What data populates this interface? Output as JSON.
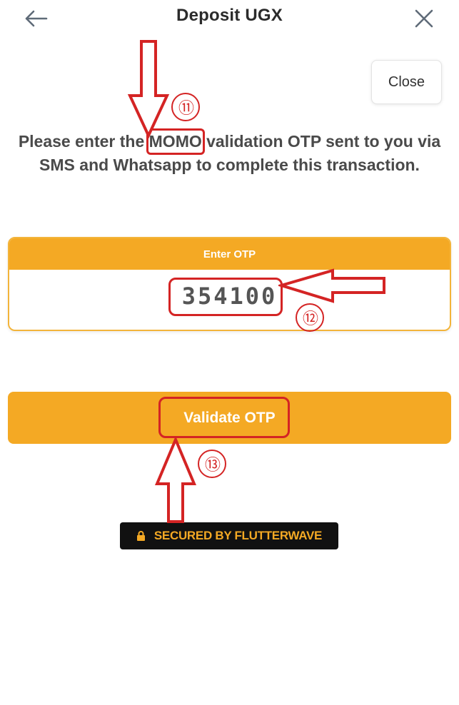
{
  "header": {
    "title": "Deposit UGX",
    "back_icon": "arrow-left-icon",
    "close_icon": "close-x-icon"
  },
  "close_button": {
    "label": "Close"
  },
  "instruction": {
    "before": "Please enter the ",
    "highlight": "MOMO",
    "after": " validation OTP sent to you via",
    "line2": "SMS and Whatsapp to complete this transaction."
  },
  "otp": {
    "header_label": "Enter OTP",
    "value": "354100"
  },
  "validate_button": {
    "label": "Validate OTP"
  },
  "secured_badge": {
    "icon": "lock-icon",
    "label": "SECURED BY FLUTTERWAVE"
  },
  "annotations": {
    "step_11": "⑪",
    "step_12": "⑫",
    "step_13": "⑬"
  },
  "colors": {
    "accent": "#f4a924",
    "annotation": "#d42424",
    "badge_bg": "#111111"
  }
}
